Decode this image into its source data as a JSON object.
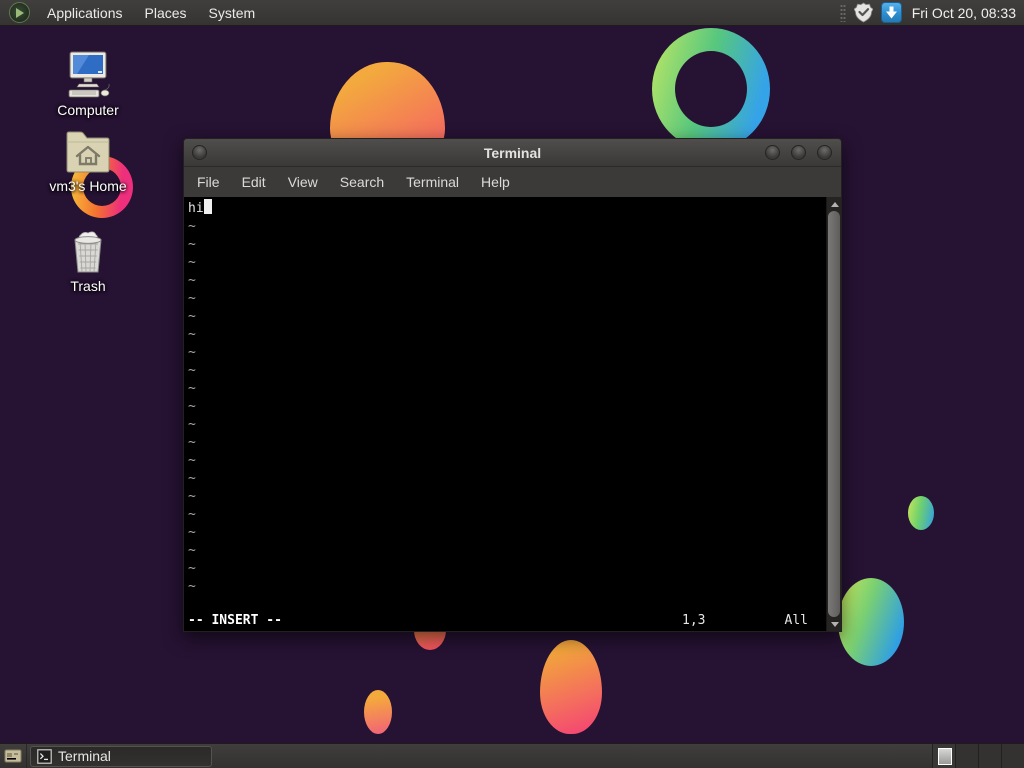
{
  "panel": {
    "menus": [
      {
        "label": "Applications"
      },
      {
        "label": "Places"
      },
      {
        "label": "System"
      }
    ],
    "clock": "Fri Oct 20, 08:33"
  },
  "desktop": {
    "icons": [
      {
        "label": "Computer"
      },
      {
        "label": "vm3's Home"
      },
      {
        "label": "Trash"
      }
    ]
  },
  "terminal_window": {
    "title": "Terminal",
    "menu": [
      "File",
      "Edit",
      "View",
      "Search",
      "Terminal",
      "Help"
    ],
    "buffer": {
      "first_line": "hi",
      "tilde": "~",
      "tilde_count": 21
    },
    "status": {
      "mode": "-- INSERT --",
      "ruler": "1,3",
      "scroll": "All"
    }
  },
  "taskbar": {
    "window_button": "Terminal"
  },
  "colors": {
    "desktop_background": "#261233",
    "panel_background": "#3a3938",
    "terminal_background": "#000000",
    "update_icon_blue": "#2d8ecf",
    "blob_orange": "#f3a93e",
    "blob_pink": "#ee2f7d",
    "blob_green": "#a8e06a",
    "blob_blue": "#2f9fe4"
  }
}
